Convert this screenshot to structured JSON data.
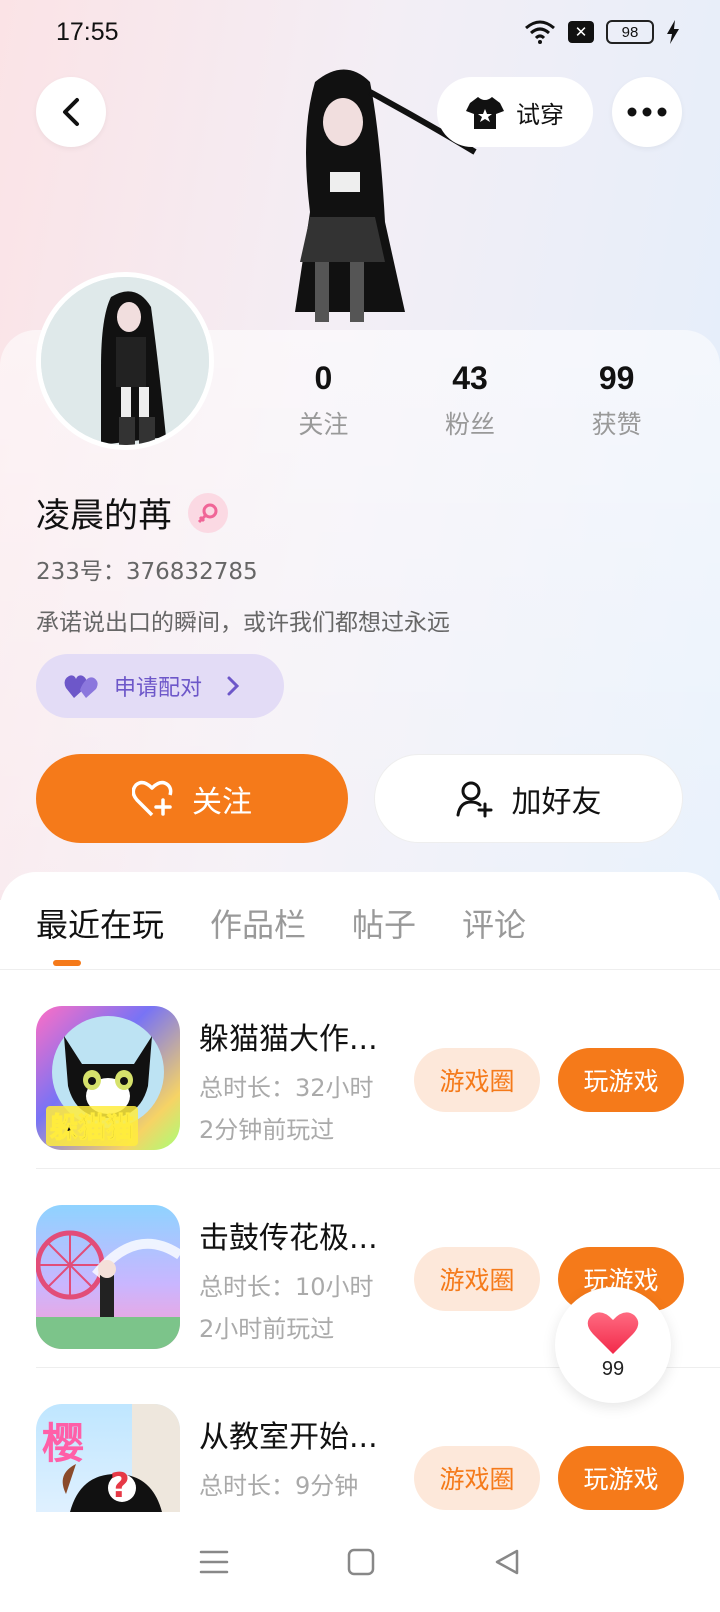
{
  "status": {
    "time": "17:55",
    "battery": "98",
    "sim": "✕"
  },
  "header": {
    "try_on_label": "试穿"
  },
  "profile": {
    "name": "凌晨的苒",
    "gender_symbol": "⚲",
    "uid": "233号：376832785",
    "bio": "承诺说出口的瞬间，或许我们都想过永远",
    "pair_label": "申请配对"
  },
  "stats": [
    {
      "value": "0",
      "label": "关注"
    },
    {
      "value": "43",
      "label": "粉丝"
    },
    {
      "value": "99",
      "label": "获赞"
    }
  ],
  "actions": {
    "follow_label": "关注",
    "add_friend_label": "加好友"
  },
  "tabs": [
    {
      "label": "最近在玩",
      "active": true
    },
    {
      "label": "作品栏",
      "active": false
    },
    {
      "label": "帖子",
      "active": false
    },
    {
      "label": "评论",
      "active": false
    }
  ],
  "games": [
    {
      "title": "躲猫猫大作...",
      "duration": "总时长：32小时",
      "last_played": "2分钟前玩过",
      "circle_label": "游戏圈",
      "play_label": "玩游戏",
      "icon_text": "躲猫猫"
    },
    {
      "title": "击鼓传花极...",
      "duration": "总时长：10小时",
      "last_played": "2小时前玩过",
      "circle_label": "游戏圈",
      "play_label": "玩游戏",
      "icon_text": ""
    },
    {
      "title": "从教室开始...",
      "duration": "总时长：9分钟",
      "last_played": "",
      "circle_label": "游戏圈",
      "play_label": "玩游戏",
      "icon_text": "樱"
    }
  ],
  "like_fab": {
    "count": "99"
  },
  "colors": {
    "accent": "#f57a1a",
    "accent_light": "#fde8da",
    "pair_bg": "#e3dcf6",
    "pair_text": "#6d57c9"
  }
}
